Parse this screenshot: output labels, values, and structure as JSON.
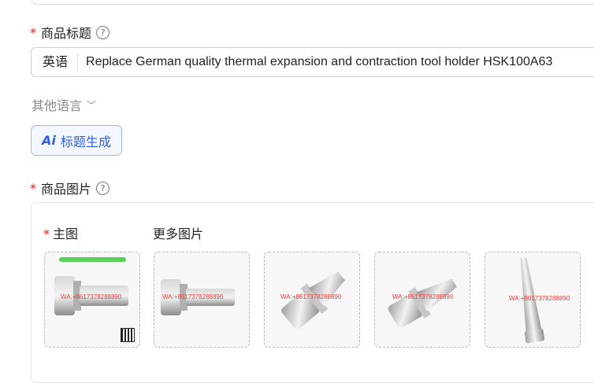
{
  "form": {
    "title_section": {
      "label": "商品标题",
      "lang_prefix": "英语",
      "value": "Replace German quality thermal expansion and contraction tool holder HSK100A63"
    },
    "other_languages": {
      "label": "其他语言"
    },
    "ai_button": {
      "icon_text": "Ai",
      "label": "标题生成"
    },
    "images_section": {
      "label": "商品图片",
      "main_label": "主图",
      "more_label": "更多图片",
      "images": [
        {
          "name": "main-image",
          "watermark": "WA:+8617378288890"
        },
        {
          "name": "more-image-1",
          "watermark": "WA:+8617378288890"
        },
        {
          "name": "more-image-2",
          "watermark": "WA:+8617378288890"
        },
        {
          "name": "more-image-3",
          "watermark": "WA:+8617378288890"
        },
        {
          "name": "more-image-4",
          "watermark": "WA:+8617378288890"
        }
      ]
    }
  },
  "colors": {
    "required_star": "#e02020",
    "accent": "#2f5fe0"
  }
}
